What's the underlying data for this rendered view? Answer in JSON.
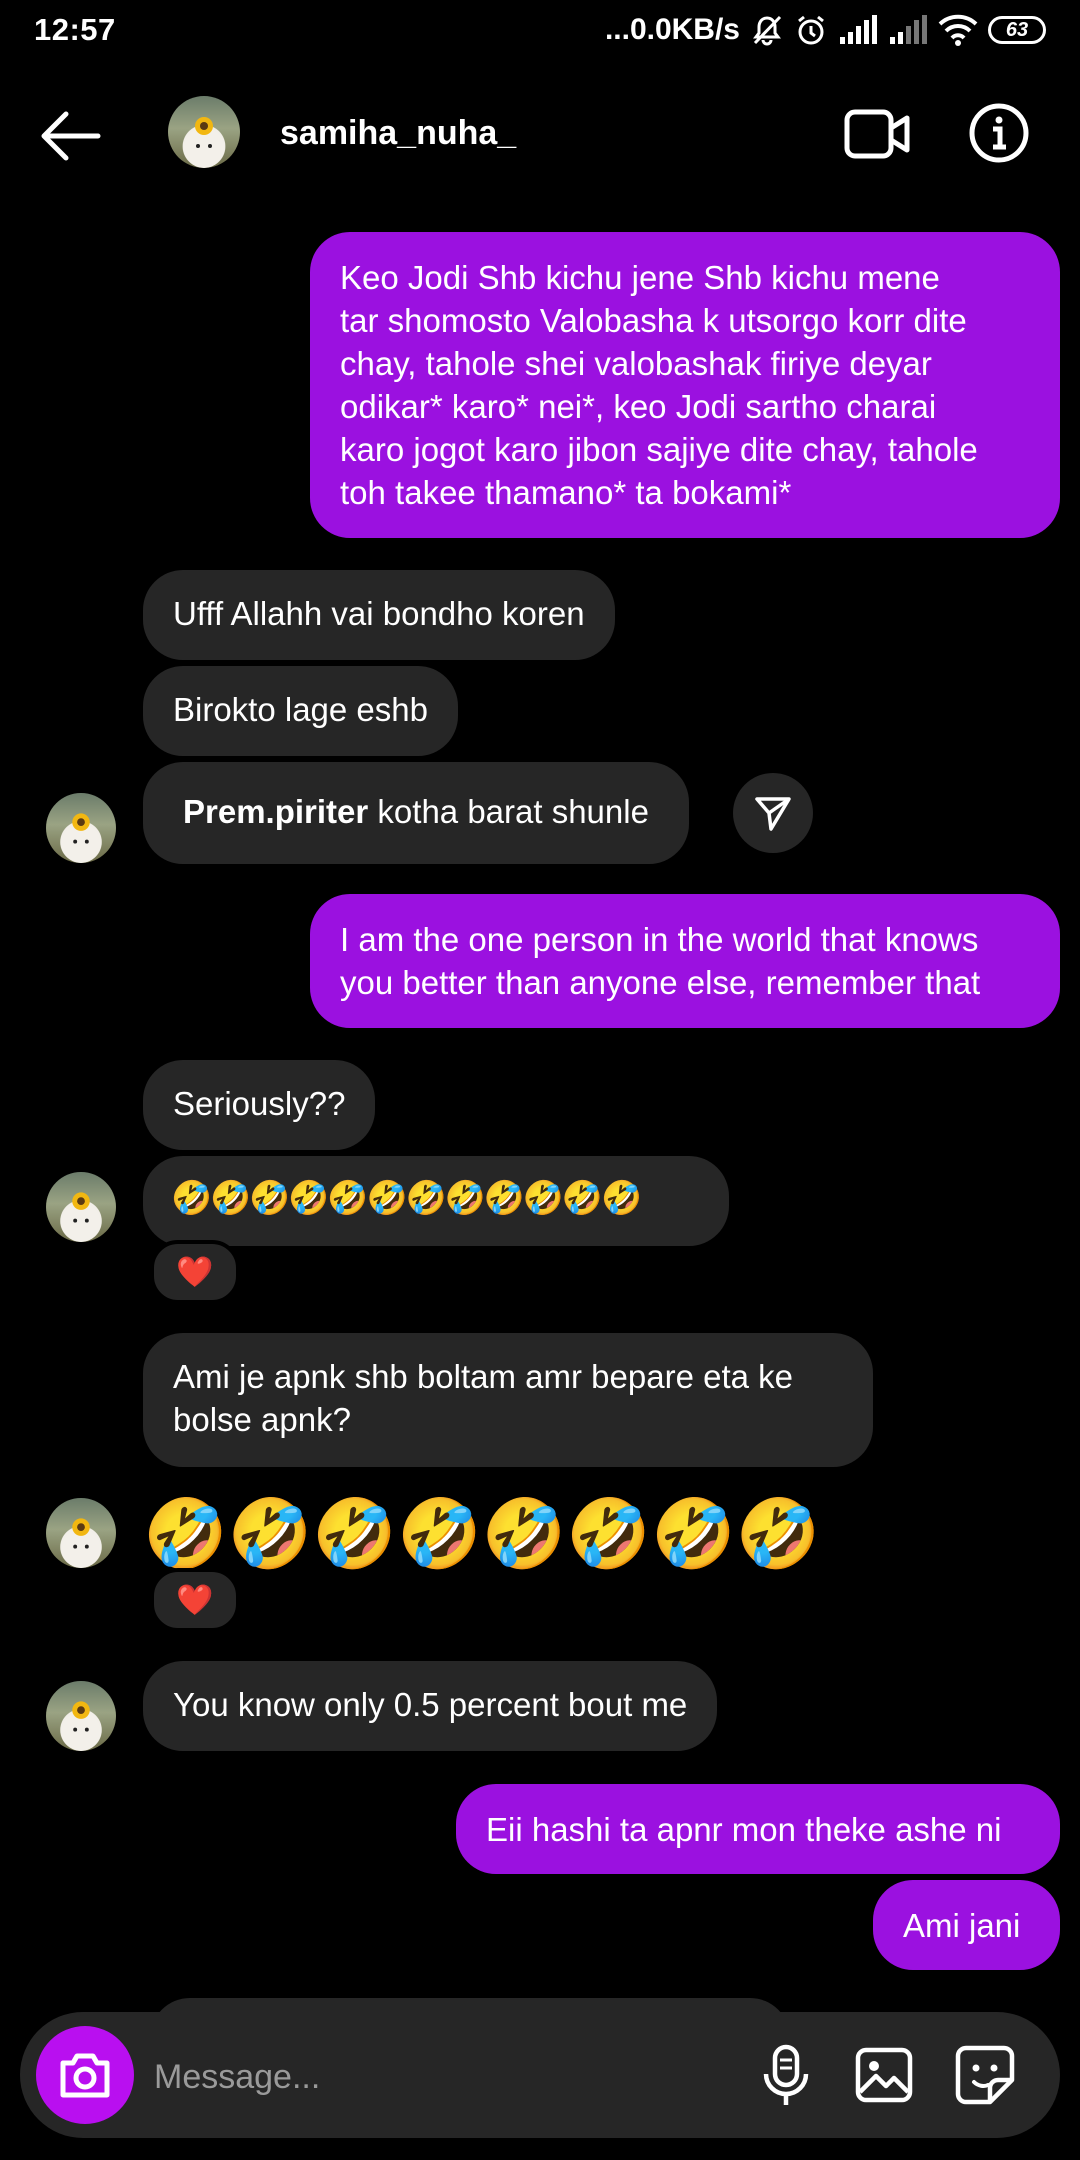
{
  "status_bar": {
    "time": "12:57",
    "speed": "...0.0KB/s",
    "battery": "63",
    "icons": [
      "mute-icon",
      "alarm-icon",
      "signal-icon",
      "signal-weak-icon",
      "wifi-icon",
      "battery-icon"
    ]
  },
  "header": {
    "username": "samiha_nuha_",
    "icons": [
      "back-arrow-icon",
      "video-call-icon",
      "info-icon"
    ]
  },
  "messages": {
    "m1": "Keo Jodi Shb kichu jene Shb kichu mene\ntar shomosto Valobasha k utsorgo korr dite\nchay, tahole shei valobashak firiye deyar\nodikar* karo* nei*, keo Jodi sartho charai\nkaro jogot karo jibon sajiye dite chay, tahole\ntoh takee thamano*  ta bokami*",
    "m2": "Ufff Allahh vai bondho koren",
    "m3": "Birokto lage eshb",
    "m4_bold": "Prem.piriter",
    "m4_rest": " kotha barat shunle",
    "m5": "I am the one person in the world that knows\nyou better than anyone else, remember that",
    "m6": "Seriously??",
    "m7": "🤣🤣🤣🤣🤣🤣🤣🤣🤣🤣🤣🤣",
    "m8": "Ami je apnk shb boltam amr bepare eta ke\nbolse apnk?",
    "m9": "🤣🤣🤣🤣🤣🤣🤣🤣",
    "m10": "You know only 0.5 percent bout me",
    "m11": "Eii hashi ta apnr mon theke ashe ni",
    "m12": "Ami jani"
  },
  "reactions": {
    "r1": "❤️",
    "r2": "❤️"
  },
  "composer": {
    "placeholder": "Message..."
  },
  "colors": {
    "outgoing_bubble": "#9b11e0",
    "incoming_bubble": "#262626",
    "camera_button": "#b90ff0",
    "background": "#000000"
  }
}
